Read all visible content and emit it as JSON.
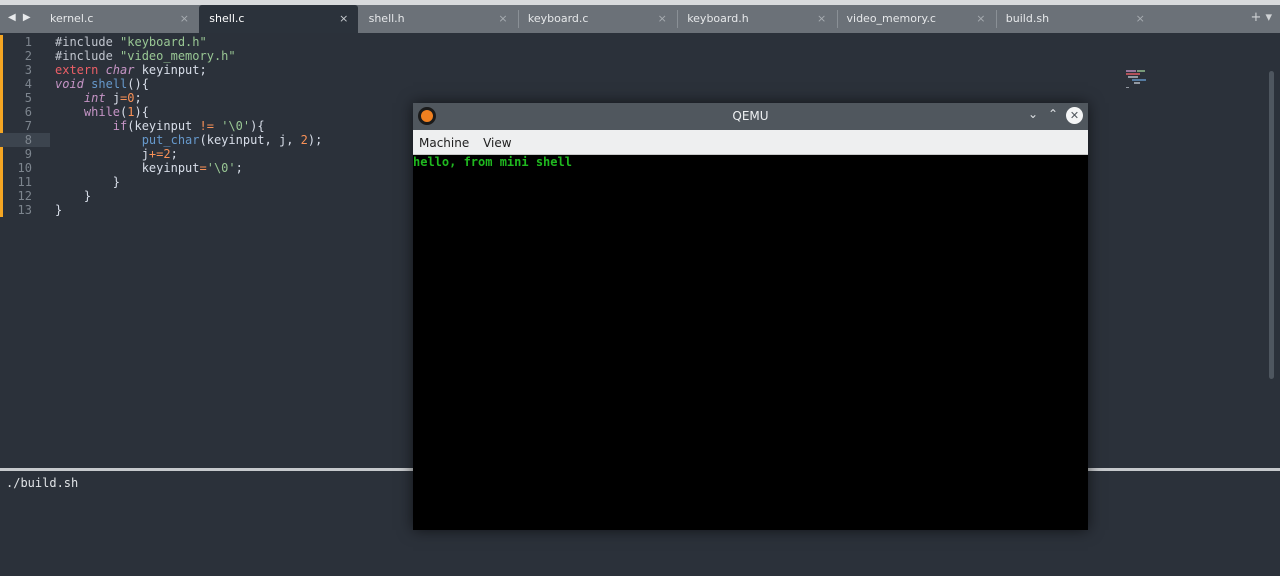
{
  "tabs": [
    {
      "label": "kernel.c",
      "close": "×"
    },
    {
      "label": "shell.c",
      "close": "×",
      "active": true
    },
    {
      "label": "shell.h",
      "close": "×"
    },
    {
      "label": "keyboard.c",
      "close": "×"
    },
    {
      "label": "keyboard.h",
      "close": "×"
    },
    {
      "label": "video_memory.c",
      "close": "×"
    },
    {
      "label": "build.sh",
      "close": "×"
    }
  ],
  "nav_arrows": "◀ ▶",
  "tab_controls": "+ ▾",
  "editor": {
    "current_line": 8,
    "lines": [
      [
        [
          "#include ",
          "pre"
        ],
        [
          "\"keyboard.h\"",
          "str"
        ]
      ],
      [
        [
          "#include ",
          "pre"
        ],
        [
          "\"video_memory.h\"",
          "str"
        ]
      ],
      [
        [
          "extern ",
          "kw"
        ],
        [
          "char",
          "type"
        ],
        [
          " keyinput;",
          "txt"
        ]
      ],
      [
        [
          "void",
          "type"
        ],
        [
          " ",
          "txt"
        ],
        [
          "shell",
          "fn"
        ],
        [
          "(){",
          "txt"
        ]
      ],
      [
        [
          "    ",
          "txt"
        ],
        [
          "int",
          "type"
        ],
        [
          " j",
          "txt"
        ],
        [
          "=",
          "op"
        ],
        [
          "0",
          "num"
        ],
        [
          ";",
          "txt"
        ]
      ],
      [
        [
          "    ",
          "txt"
        ],
        [
          "while",
          "ctl"
        ],
        [
          "(",
          "txt"
        ],
        [
          "1",
          "num"
        ],
        [
          "){",
          "txt"
        ]
      ],
      [
        [
          "        ",
          "txt"
        ],
        [
          "if",
          "ctl"
        ],
        [
          "(keyinput ",
          "txt"
        ],
        [
          "!=",
          "op"
        ],
        [
          " ",
          "txt"
        ],
        [
          "'\\0'",
          "str"
        ],
        [
          "){",
          "txt"
        ]
      ],
      [
        [
          "            ",
          "txt"
        ],
        [
          "put_char",
          "fn"
        ],
        [
          "(keyinput, j, ",
          "txt"
        ],
        [
          "2",
          "num"
        ],
        [
          ");",
          "txt"
        ]
      ],
      [
        [
          "            j",
          "txt"
        ],
        [
          "+=",
          "op"
        ],
        [
          "2",
          "num"
        ],
        [
          ";",
          "txt"
        ]
      ],
      [
        [
          "            keyinput",
          "txt"
        ],
        [
          "=",
          "op"
        ],
        [
          "'\\0'",
          "str"
        ],
        [
          ";",
          "txt"
        ]
      ],
      [
        [
          "        }",
          "txt"
        ]
      ],
      [
        [
          "    }",
          "txt"
        ]
      ],
      [
        [
          "}",
          "txt"
        ]
      ]
    ]
  },
  "panel": {
    "command": "./build.sh"
  },
  "qemu": {
    "title": "QEMU",
    "menu": [
      "Machine",
      "View"
    ],
    "minimize": "⌄",
    "maximize": "⌃",
    "close": "✕",
    "output": "hello, from mini shell"
  },
  "colors": {
    "accent": "#f5a623",
    "editor_bg": "#2b313a",
    "qemu_text": "#1fb81f"
  }
}
